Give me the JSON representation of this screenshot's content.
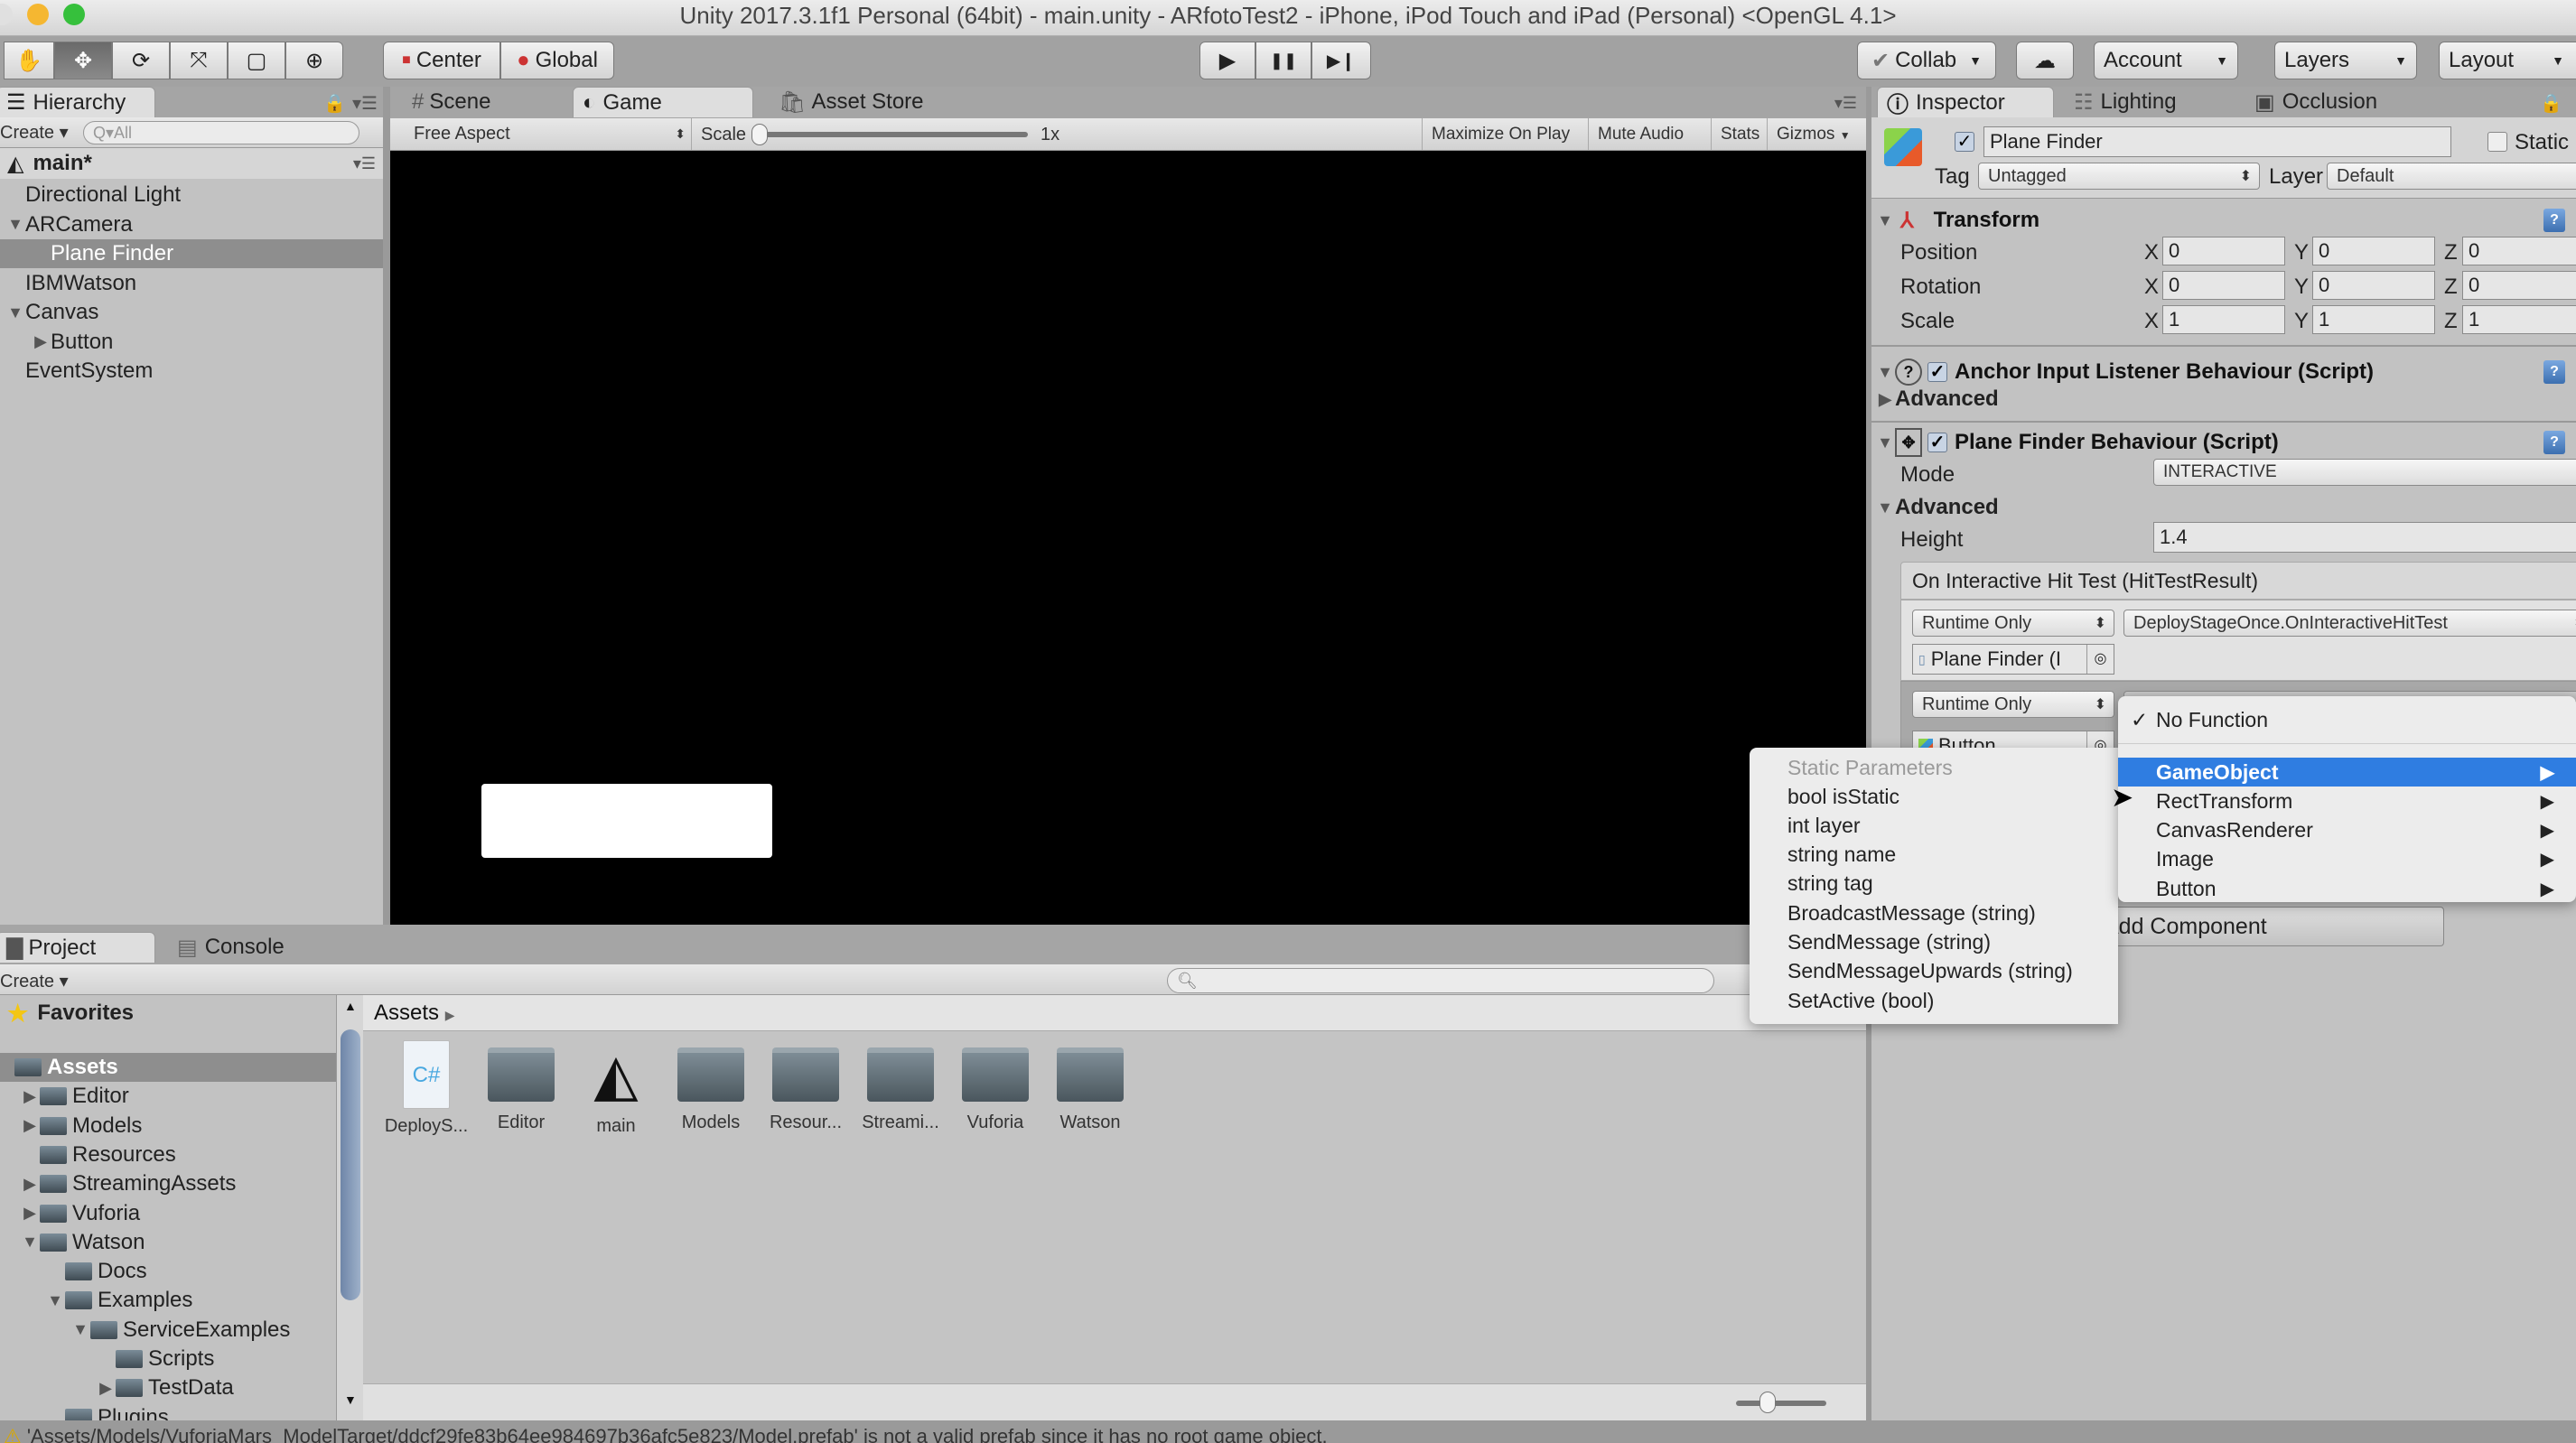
{
  "window": {
    "title": "Unity 2017.3.1f1 Personal (64bit) - main.unity - ARfotoTest2 - iPhone, iPod Touch and iPad (Personal) <OpenGL 4.1>"
  },
  "toolbar": {
    "tools": [
      {
        "name": "hand-tool",
        "glyph": "✋"
      },
      {
        "name": "move-tool",
        "glyph": "✥"
      },
      {
        "name": "rotate-tool",
        "glyph": "⟳"
      },
      {
        "name": "scale-tool",
        "glyph": "⤧"
      },
      {
        "name": "rect-tool",
        "glyph": "▢"
      },
      {
        "name": "transform-tool",
        "glyph": "⊕"
      }
    ],
    "pivot_label": "Center",
    "space_label": "Global",
    "play_glyph": "▶",
    "pause_glyph": "❚❚",
    "step_glyph": "▶❙",
    "collab_label": "Collab",
    "account_label": "Account",
    "layers_label": "Layers",
    "layout_label": "Layout"
  },
  "hierarchy": {
    "tab_label": "Hierarchy",
    "create_label": "Create",
    "search_placeholder": "Q▾All",
    "scene_name": "main*",
    "items": [
      {
        "label": "Directional Light",
        "indent": 0,
        "arrow": ""
      },
      {
        "label": "ARCamera",
        "indent": 0,
        "arrow": "▼"
      },
      {
        "label": "Plane Finder",
        "indent": 1,
        "arrow": "",
        "selected": true
      },
      {
        "label": "IBMWatson",
        "indent": 0,
        "arrow": ""
      },
      {
        "label": "Canvas",
        "indent": 0,
        "arrow": "▼"
      },
      {
        "label": "Button",
        "indent": 1,
        "arrow": "▶"
      },
      {
        "label": "EventSystem",
        "indent": 0,
        "arrow": ""
      }
    ]
  },
  "center_tabs": {
    "scene_label": "Scene",
    "game_label": "Game",
    "asset_store_label": "Asset Store"
  },
  "game_toolbar": {
    "aspect": "Free Aspect",
    "scale_label": "Scale",
    "scale_value": "1x",
    "maximize_label": "Maximize On Play",
    "mute_label": "Mute Audio",
    "stats_label": "Stats",
    "gizmos_label": "Gizmos"
  },
  "inspector": {
    "tabs": [
      "Inspector",
      "Lighting",
      "Occlusion"
    ],
    "object_name": "Plane Finder",
    "static_label": "Static",
    "tag_label": "Tag",
    "tag_value": "Untagged",
    "layer_label": "Layer",
    "layer_value": "Default",
    "transform": {
      "title": "Transform",
      "rows": [
        {
          "label": "Position",
          "x": "0",
          "y": "0",
          "z": "0"
        },
        {
          "label": "Rotation",
          "x": "0",
          "y": "0",
          "z": "0"
        },
        {
          "label": "Scale",
          "x": "1",
          "y": "1",
          "z": "1"
        }
      ]
    },
    "anchor_component": {
      "title": "Anchor Input Listener Behaviour (Script)",
      "advanced_label": "Advanced"
    },
    "plane_finder_component": {
      "title": "Plane Finder Behaviour (Script)",
      "mode_label": "Mode",
      "mode_value": "INTERACTIVE",
      "advanced_label": "Advanced",
      "height_label": "Height",
      "height_value": "1.4",
      "event_title": "On Interactive Hit Test (HitTestResult)",
      "listener1": {
        "runtime": "Runtime Only",
        "function": "DeployStageOnce.OnInteractiveHitTest",
        "object": "Plane Finder (I"
      },
      "listener2": {
        "runtime": "Runtime Only",
        "function": "No Function",
        "object": "Button"
      }
    },
    "add_component_label": "Add Component"
  },
  "function_menu": {
    "checked_item": "No Function",
    "items": [
      "GameObject",
      "RectTransform",
      "CanvasRenderer",
      "Image",
      "Button"
    ],
    "highlighted": "GameObject"
  },
  "static_params_menu": {
    "header": "Static Parameters",
    "items": [
      "bool isStatic",
      "int layer",
      "string name",
      "string tag",
      "BroadcastMessage (string)",
      "SendMessage (string)",
      "SendMessageUpwards (string)",
      "SetActive (bool)"
    ]
  },
  "project": {
    "tab_label": "Project",
    "console_label": "Console",
    "create_label": "Create",
    "favorites_label": "Favorites",
    "breadcrumb": "Assets",
    "tree": [
      {
        "label": "Assets",
        "indent": 0,
        "arrow": "",
        "selected": true
      },
      {
        "label": "Editor",
        "indent": 1,
        "arrow": "▶"
      },
      {
        "label": "Models",
        "indent": 1,
        "arrow": "▶"
      },
      {
        "label": "Resources",
        "indent": 1,
        "arrow": ""
      },
      {
        "label": "StreamingAssets",
        "indent": 1,
        "arrow": "▶"
      },
      {
        "label": "Vuforia",
        "indent": 1,
        "arrow": "▶"
      },
      {
        "label": "Watson",
        "indent": 1,
        "arrow": "▼"
      },
      {
        "label": "Docs",
        "indent": 2,
        "arrow": ""
      },
      {
        "label": "Examples",
        "indent": 2,
        "arrow": "▼"
      },
      {
        "label": "ServiceExamples",
        "indent": 3,
        "arrow": "▼"
      },
      {
        "label": "Scripts",
        "indent": 4,
        "arrow": ""
      },
      {
        "label": "TestData",
        "indent": 4,
        "arrow": "▶"
      },
      {
        "label": "Plugins",
        "indent": 2,
        "arrow": ""
      }
    ],
    "assets": [
      {
        "label": "DeployS...",
        "type": "script"
      },
      {
        "label": "Editor",
        "type": "folder"
      },
      {
        "label": "main",
        "type": "scene"
      },
      {
        "label": "Models",
        "type": "folder"
      },
      {
        "label": "Resour...",
        "type": "folder"
      },
      {
        "label": "Streami...",
        "type": "folder"
      },
      {
        "label": "Vuforia",
        "type": "folder"
      },
      {
        "label": "Watson",
        "type": "folder"
      }
    ]
  },
  "status_bar": {
    "message": "'Assets/Models/VuforiaMars_ModelTarget/ddcf29fe83b64ee984697b36afc5e823/Model.prefab' is not a valid prefab since it has no root game object."
  }
}
